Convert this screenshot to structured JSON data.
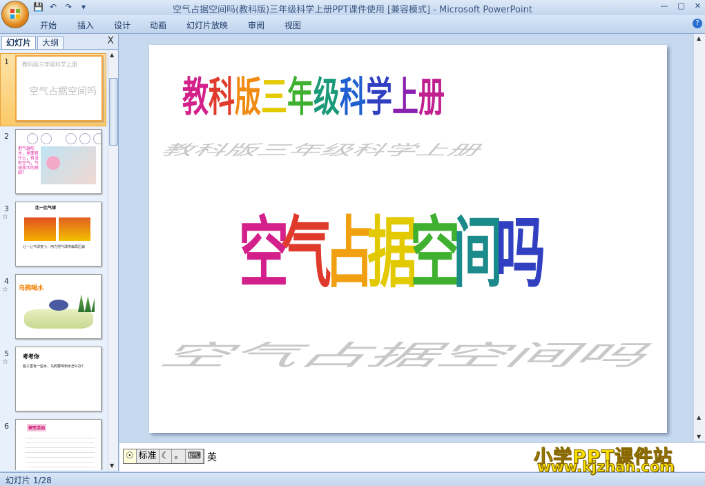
{
  "window": {
    "title": "空气占据空间吗(教科版)三年级科学上册PPT课件使用 [兼容模式] - Microsoft PowerPoint"
  },
  "quick_access": [
    "save-icon",
    "undo-icon",
    "redo-icon",
    "customize-icon"
  ],
  "ribbon": {
    "tabs": [
      "开始",
      "插入",
      "设计",
      "动画",
      "幻灯片放映",
      "审阅",
      "视图"
    ]
  },
  "slides_panel": {
    "tabs": [
      "幻灯片",
      "大纲"
    ],
    "close": "X",
    "slides": [
      {
        "num": "1",
        "title": "教科版三年级科学上册",
        "subtitle": "空气占据空间吗"
      },
      {
        "num": "2",
        "text": "把气球吹大，里面有什么，有没有空气，气球变大的原因？"
      },
      {
        "num": "3",
        "title": "比一比气球",
        "text": "让一让气球变小，用力把气球挤扁再压扁"
      },
      {
        "num": "4",
        "title": "乌鸦喝水"
      },
      {
        "num": "5",
        "title": "考考你",
        "text": "瓶子里有一些水，乌鸦要喝到水怎么办？"
      },
      {
        "num": "6",
        "title": "探究活动"
      }
    ]
  },
  "slide": {
    "title": "教科版三年级科学上册",
    "main": "空气占据空间吗",
    "title_colors": [
      "#d3208a",
      "#e03a2d",
      "#f08a10",
      "#e2c900",
      "#40b030",
      "#1a9a7a",
      "#2060d0",
      "#3040c0",
      "#8a20b0",
      "#c02090"
    ]
  },
  "ime": {
    "mode": "标准",
    "label": "英"
  },
  "status": {
    "text": "幻灯片 1/28"
  },
  "watermark": {
    "line1": "小学PPT课件站",
    "line2": "www.kjzhan.com"
  }
}
